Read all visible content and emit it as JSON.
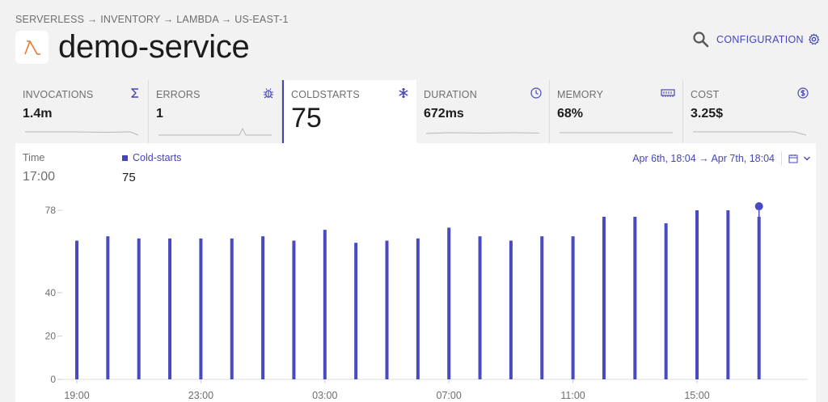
{
  "breadcrumb": "SERVERLESS → INVENTORY → LAMBDA → US-EAST-1",
  "service": {
    "title": "demo-service",
    "logo_icon": "lambda-icon"
  },
  "header": {
    "search_icon": "search-icon",
    "config_label": "CONFIGURATION",
    "config_icon": "gear-icon"
  },
  "metrics": [
    {
      "label": "INVOCATIONS",
      "value": "1.4m",
      "icon": "sigma-icon"
    },
    {
      "label": "ERRORS",
      "value": "1",
      "icon": "bug-icon"
    },
    {
      "label": "COLDSTARTS",
      "value": "75",
      "icon": "snowflake-icon",
      "active": true
    },
    {
      "label": "DURATION",
      "value": "672ms",
      "icon": "clock-icon"
    },
    {
      "label": "MEMORY",
      "value": "68%",
      "icon": "memory-icon"
    },
    {
      "label": "COST",
      "value": "3.25$",
      "icon": "dollar-icon"
    }
  ],
  "chart_panel": {
    "time_label": "Time",
    "time_value": "17:00",
    "series_label": "Cold-starts",
    "series_value": "75",
    "date_range": "Apr 6th, 18:04 → Apr 7th, 18:04"
  },
  "colors": {
    "accent": "#4545b8",
    "accent_alt": "#4a4ac0"
  },
  "chart_data": {
    "type": "bar",
    "title": "",
    "xlabel": "",
    "ylabel": "",
    "ylim": [
      0,
      78
    ],
    "yticks": [
      0,
      20,
      40,
      78
    ],
    "xticks": [
      "19:00",
      "23:00",
      "03:00",
      "07:00",
      "11:00",
      "15:00"
    ],
    "categories": [
      "19:00",
      "20:00",
      "21:00",
      "22:00",
      "23:00",
      "00:00",
      "01:00",
      "02:00",
      "03:00",
      "04:00",
      "05:00",
      "06:00",
      "07:00",
      "08:00",
      "09:00",
      "10:00",
      "11:00",
      "12:00",
      "13:00",
      "14:00",
      "15:00",
      "16:00",
      "17:00"
    ],
    "series": [
      {
        "name": "Cold-starts",
        "values": [
          64,
          66,
          65,
          65,
          65,
          65,
          66,
          64,
          69,
          63,
          64,
          65,
          70,
          66,
          64,
          66,
          66,
          75,
          75,
          72,
          78,
          78,
          75
        ]
      }
    ],
    "highlight_index": 22,
    "grid": false
  }
}
